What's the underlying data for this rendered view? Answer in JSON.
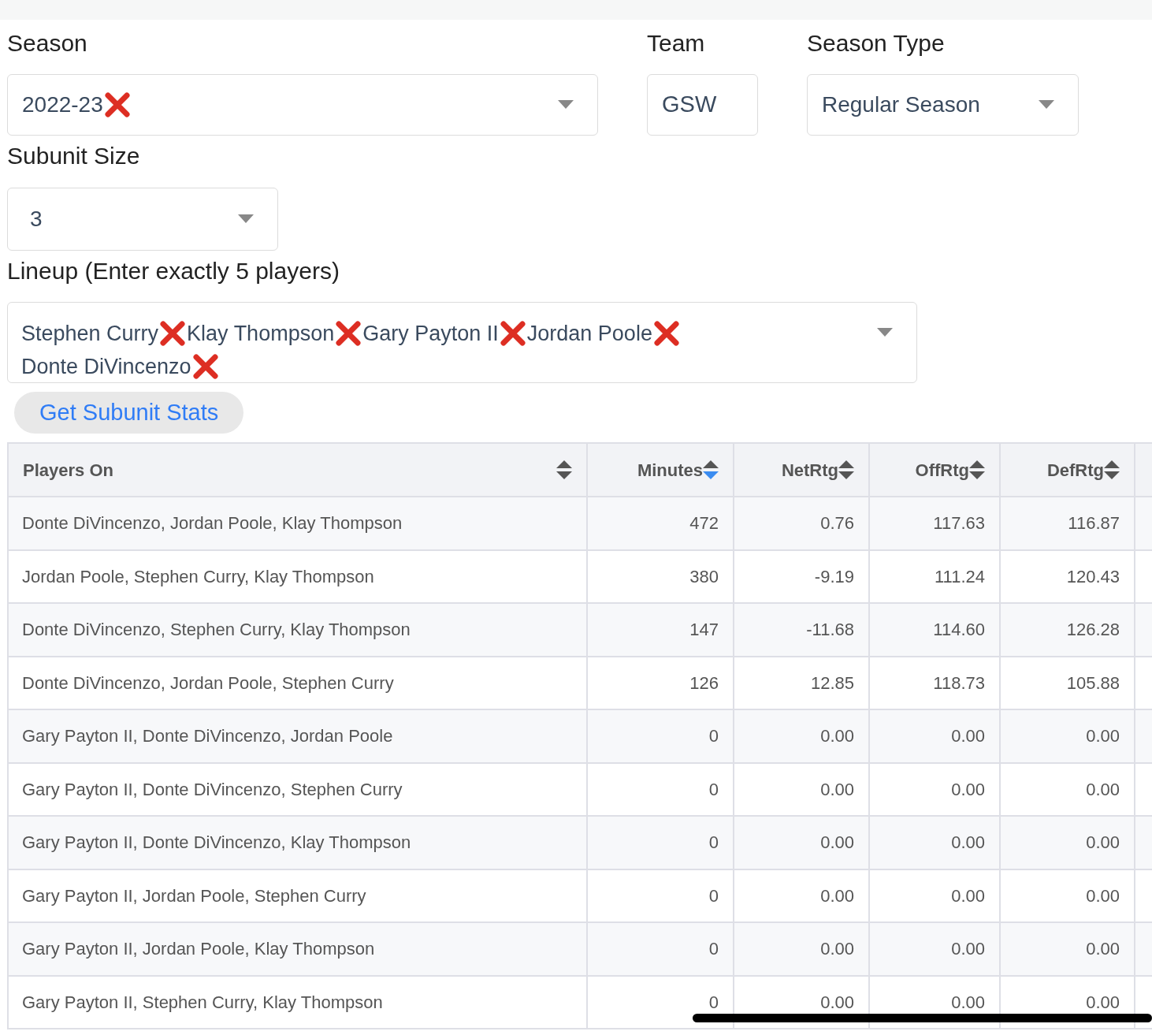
{
  "filters": [
    {
      "label": "Season",
      "values": [
        "2022-23"
      ],
      "removable": true,
      "kind": "wide"
    },
    {
      "label": "Team",
      "values": [
        "GSW"
      ],
      "removable": false,
      "kind": "narrow"
    },
    {
      "label": "Season Type",
      "values": [
        "Regular Season"
      ],
      "removable": false,
      "kind": "medium"
    }
  ],
  "subunit_size": {
    "label": "Subunit Size",
    "value": "3"
  },
  "lineup": {
    "label": "Lineup (Enter exactly 5 players)",
    "players": [
      "Stephen Curry",
      "Klay Thompson",
      "Gary Payton II",
      "Jordan Poole",
      "Donte DiVincenzo"
    ]
  },
  "submit_button": "Get Subunit Stats",
  "table": {
    "columns": [
      {
        "label": "Players On",
        "sorted": false
      },
      {
        "label": "Minutes",
        "sorted": true
      },
      {
        "label": "NetRtg",
        "sorted": false
      },
      {
        "label": "OffRtg",
        "sorted": false
      },
      {
        "label": "DefRtg",
        "sorted": false
      }
    ],
    "rows": [
      [
        "Donte DiVincenzo, Jordan Poole, Klay Thompson",
        "472",
        "0.76",
        "117.63",
        "116.87"
      ],
      [
        "Jordan Poole, Stephen Curry, Klay Thompson",
        "380",
        "-9.19",
        "111.24",
        "120.43"
      ],
      [
        "Donte DiVincenzo, Stephen Curry, Klay Thompson",
        "147",
        "-11.68",
        "114.60",
        "126.28"
      ],
      [
        "Donte DiVincenzo, Jordan Poole, Stephen Curry",
        "126",
        "12.85",
        "118.73",
        "105.88"
      ],
      [
        "Gary Payton II, Donte DiVincenzo, Jordan Poole",
        "0",
        "0.00",
        "0.00",
        "0.00"
      ],
      [
        "Gary Payton II, Donte DiVincenzo, Stephen Curry",
        "0",
        "0.00",
        "0.00",
        "0.00"
      ],
      [
        "Gary Payton II, Donte DiVincenzo, Klay Thompson",
        "0",
        "0.00",
        "0.00",
        "0.00"
      ],
      [
        "Gary Payton II, Jordan Poole, Stephen Curry",
        "0",
        "0.00",
        "0.00",
        "0.00"
      ],
      [
        "Gary Payton II, Jordan Poole, Klay Thompson",
        "0",
        "0.00",
        "0.00",
        "0.00"
      ],
      [
        "Gary Payton II, Stephen Curry, Klay Thompson",
        "0",
        "0.00",
        "0.00",
        "0.00"
      ]
    ]
  }
}
